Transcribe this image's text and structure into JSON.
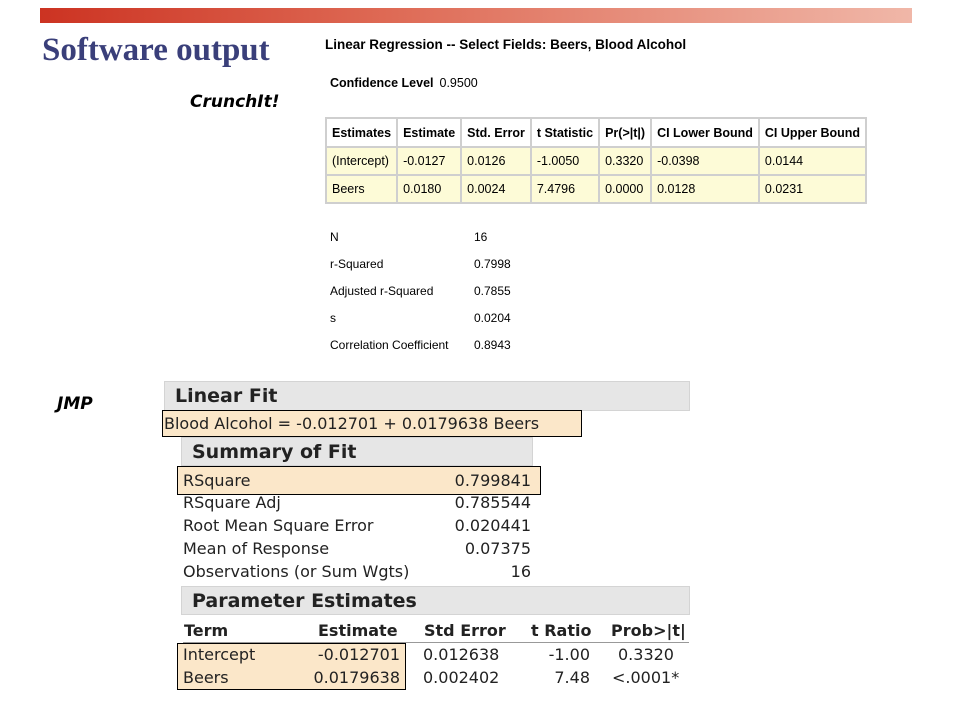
{
  "slide": {
    "title": "Software output"
  },
  "crunchit": {
    "label": "CrunchIt!",
    "heading": "Linear Regression -- Select Fields: Beers, Blood Alcohol",
    "confidence_label": "Confidence Level",
    "confidence_value": "0.9500",
    "table": {
      "headers": [
        "Estimates",
        "Estimate",
        "Std. Error",
        "t Statistic",
        "Pr(>|t|)",
        "CI Lower Bound",
        "CI Upper Bound"
      ],
      "rows": [
        [
          "(Intercept)",
          "-0.0127",
          "0.0126",
          "-1.0050",
          "0.3320",
          "-0.0398",
          "0.0144"
        ],
        [
          "Beers",
          "0.0180",
          "0.0024",
          "7.4796",
          "0.0000",
          "0.0128",
          "0.0231"
        ]
      ]
    },
    "stats": [
      {
        "label": "N",
        "value": "16"
      },
      {
        "label": "r-Squared",
        "value": "0.7998"
      },
      {
        "label": "Adjusted r-Squared",
        "value": "0.7855"
      },
      {
        "label": "s",
        "value": "0.0204"
      },
      {
        "label": "Correlation Coefficient",
        "value": "0.8943"
      }
    ]
  },
  "jmp": {
    "label": "JMP",
    "linear_fit_title": "Linear Fit",
    "equation": "Blood Alcohol = -0.012701 + 0.0179638 Beers",
    "summary_title": "Summary of Fit",
    "summary": [
      {
        "label": "RSquare",
        "value": "0.799841"
      },
      {
        "label": "RSquare Adj",
        "value": "0.785544"
      },
      {
        "label": "Root Mean Square Error",
        "value": "0.020441"
      },
      {
        "label": "Mean of Response",
        "value": "0.07375"
      },
      {
        "label": "Observations (or Sum Wgts)",
        "value": "16"
      }
    ],
    "param_title": "Parameter Estimates",
    "param_headers": [
      "Term",
      "Estimate",
      "Std Error",
      "t Ratio",
      "Prob>|t|"
    ],
    "params": [
      [
        "Intercept",
        "-0.012701",
        "0.012638",
        "-1.00",
        "0.3320"
      ],
      [
        "Beers",
        "0.0179638",
        "0.002402",
        "7.48",
        "<.0001*"
      ]
    ]
  }
}
